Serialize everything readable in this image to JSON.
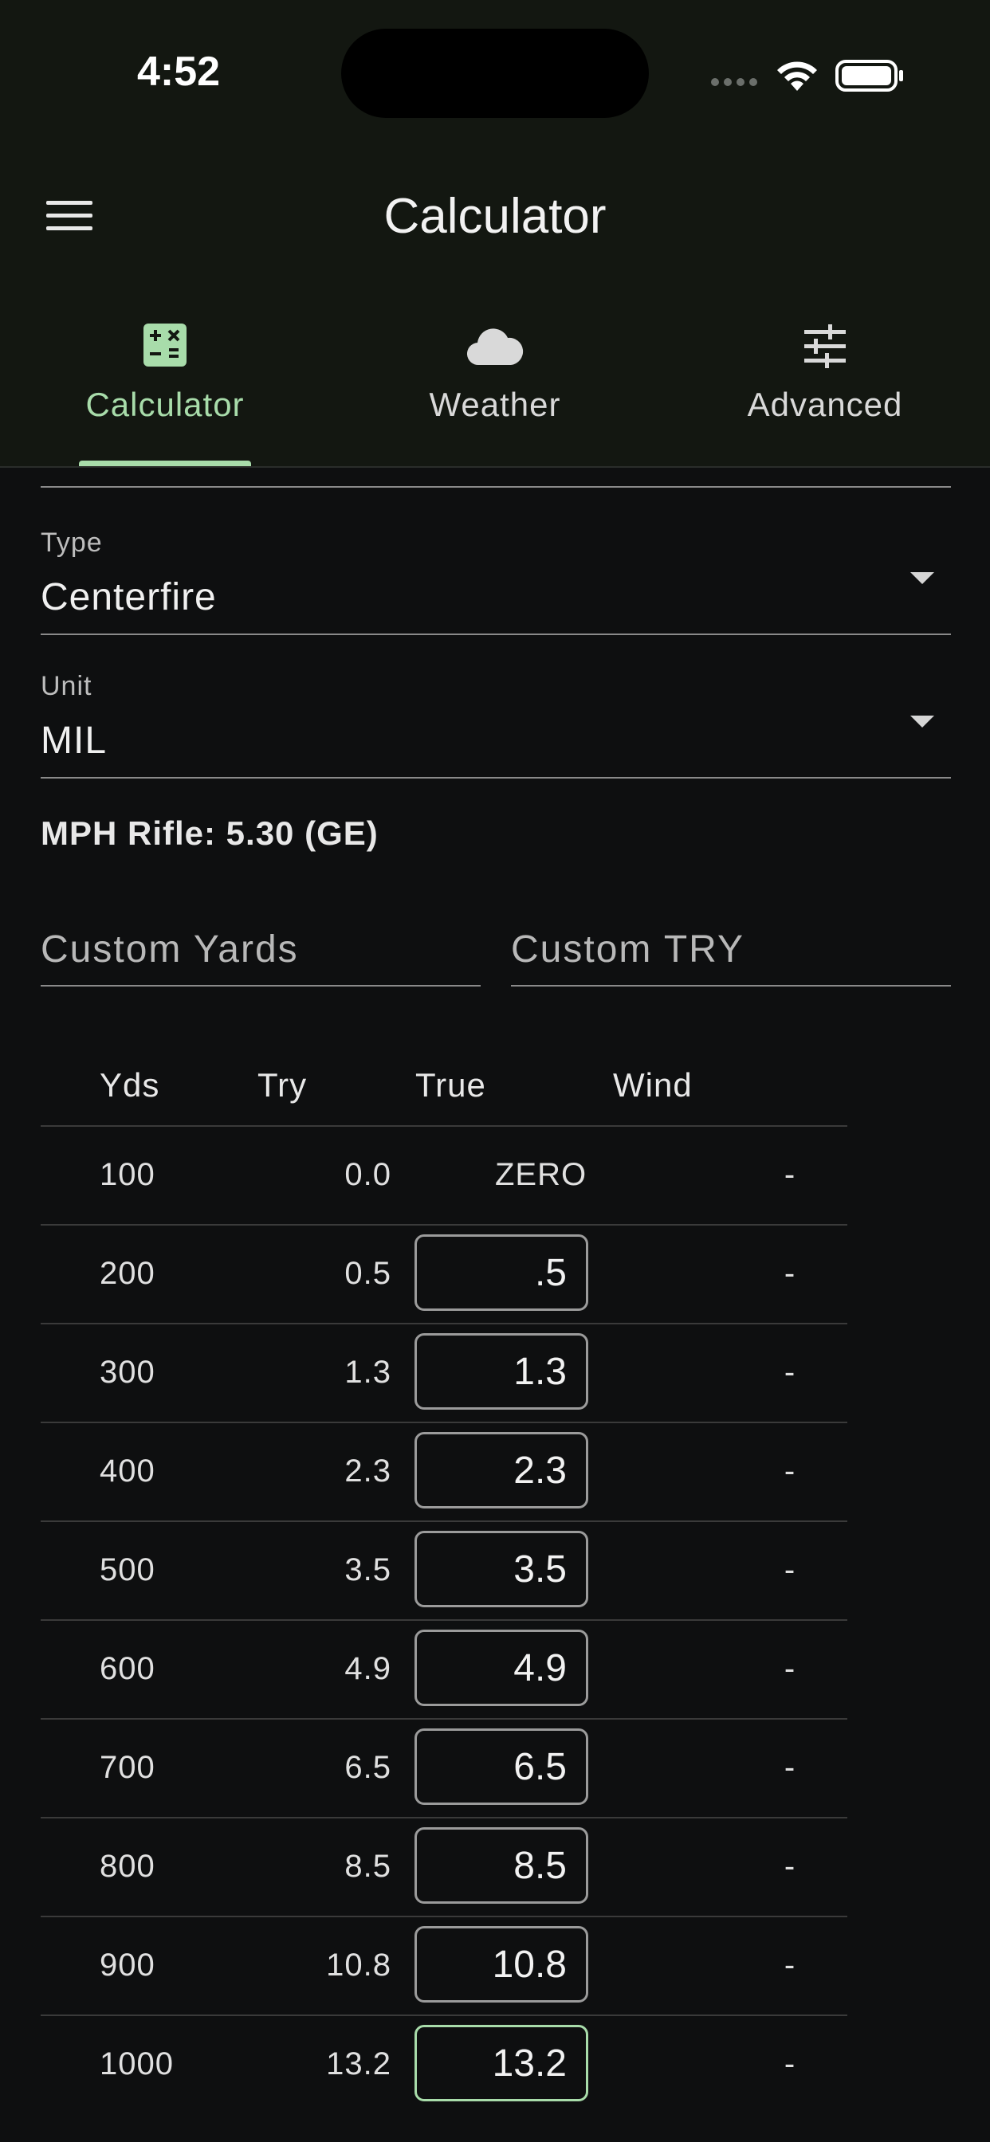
{
  "status_bar": {
    "time": "4:52"
  },
  "app_bar": {
    "title": "Calculator"
  },
  "tabs": [
    {
      "label": "Calculator",
      "icon": "calculator-icon",
      "active": true
    },
    {
      "label": "Weather",
      "icon": "cloud-icon",
      "active": false
    },
    {
      "label": "Advanced",
      "icon": "sliders-icon",
      "active": false
    }
  ],
  "form": {
    "type": {
      "label": "Type",
      "value": "Centerfire"
    },
    "unit": {
      "label": "Unit",
      "value": "MIL"
    },
    "info": "MPH Rifle: 5.30 (GE)",
    "custom_yards_placeholder": "Custom Yards",
    "custom_try_placeholder": "Custom TRY"
  },
  "table": {
    "headers": {
      "yds": "Yds",
      "try": "Try",
      "true": "True",
      "wind": "Wind"
    },
    "rows": [
      {
        "yds": "100",
        "try": "0.0",
        "true": "ZERO",
        "wind": "-"
      },
      {
        "yds": "200",
        "try": "0.5",
        "true": ".5",
        "wind": "-"
      },
      {
        "yds": "300",
        "try": "1.3",
        "true": "1.3",
        "wind": "-"
      },
      {
        "yds": "400",
        "try": "2.3",
        "true": "2.3",
        "wind": "-"
      },
      {
        "yds": "500",
        "try": "3.5",
        "true": "3.5",
        "wind": "-"
      },
      {
        "yds": "600",
        "try": "4.9",
        "true": "4.9",
        "wind": "-"
      },
      {
        "yds": "700",
        "try": "6.5",
        "true": "6.5",
        "wind": "-"
      },
      {
        "yds": "800",
        "try": "8.5",
        "true": "8.5",
        "wind": "-"
      },
      {
        "yds": "900",
        "try": "10.8",
        "true": "10.8",
        "wind": "-"
      },
      {
        "yds": "1000",
        "try": "13.2",
        "true": "13.2",
        "wind": "-"
      }
    ]
  },
  "colors": {
    "accent": "#a8dcaa",
    "background": "#0e0f10",
    "header_bg": "#131711"
  }
}
